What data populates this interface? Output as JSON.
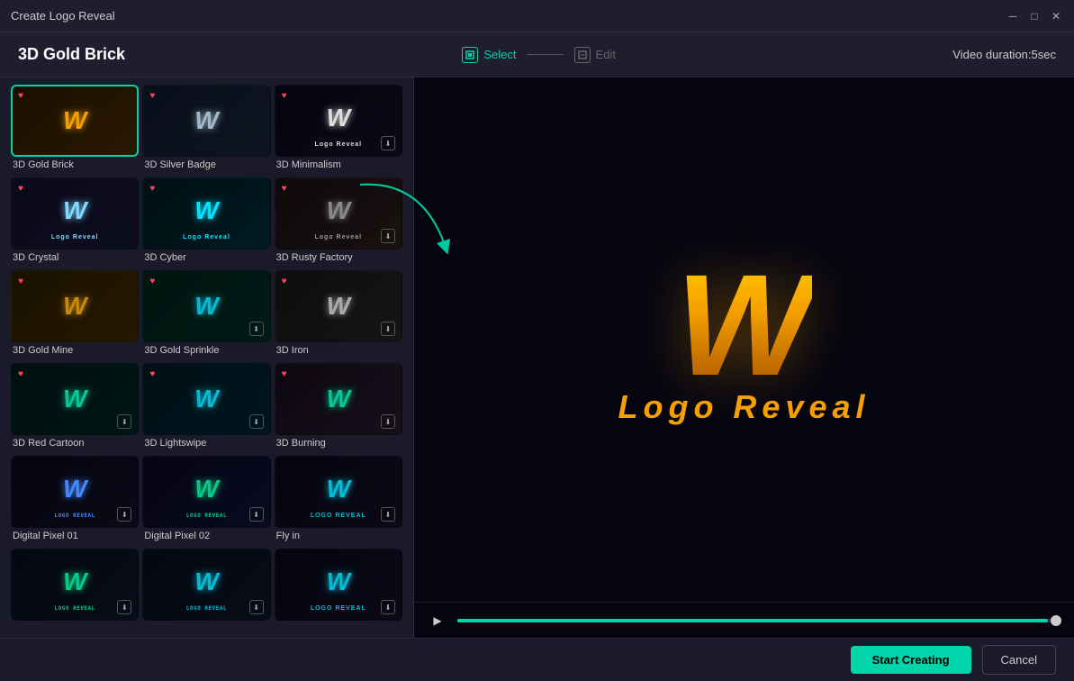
{
  "window": {
    "title": "Create Logo Reveal"
  },
  "header": {
    "title": "3D Gold Brick",
    "step1_label": "Select",
    "step2_label": "Edit",
    "duration": "Video duration:5sec"
  },
  "templates": [
    {
      "id": "3d-gold-brick",
      "name": "3D Gold Brick",
      "selected": true,
      "style": "gold-brick",
      "heart": true
    },
    {
      "id": "3d-silver-badge",
      "name": "3D Silver Badge",
      "selected": false,
      "style": "silver-badge",
      "heart": true
    },
    {
      "id": "3d-minimalism",
      "name": "3D Minimalism",
      "selected": false,
      "style": "minimalism",
      "heart": true,
      "download": true
    },
    {
      "id": "3d-crystal",
      "name": "3D Crystal",
      "selected": false,
      "style": "crystal",
      "heart": true
    },
    {
      "id": "3d-cyber",
      "name": "3D Cyber",
      "selected": false,
      "style": "cyber",
      "heart": true
    },
    {
      "id": "3d-rusty-factory",
      "name": "3D Rusty Factory",
      "selected": false,
      "style": "rusty",
      "heart": true,
      "download": true
    },
    {
      "id": "3d-gold-mine",
      "name": "3D Gold Mine",
      "selected": false,
      "style": "gold-mine",
      "heart": true
    },
    {
      "id": "3d-gold-sprinkle",
      "name": "3D Gold Sprinkle",
      "selected": false,
      "style": "sprinkle",
      "heart": true,
      "download": true
    },
    {
      "id": "3d-iron",
      "name": "3D Iron",
      "selected": false,
      "style": "iron",
      "heart": true,
      "download": true
    },
    {
      "id": "3d-red-cartoon",
      "name": "3D Red Cartoon",
      "selected": false,
      "style": "red-cartoon",
      "heart": true,
      "download": true
    },
    {
      "id": "3d-lightswipe",
      "name": "3D Lightswipe",
      "selected": false,
      "style": "lightswipe",
      "heart": true,
      "download": true
    },
    {
      "id": "3d-burning",
      "name": "3D Burning",
      "selected": false,
      "style": "burning",
      "heart": true,
      "download": true
    },
    {
      "id": "digital-pixel-01",
      "name": "Digital Pixel 01",
      "selected": false,
      "style": "pixel1",
      "heart": false,
      "download": true
    },
    {
      "id": "digital-pixel-02",
      "name": "Digital Pixel 02",
      "selected": false,
      "style": "pixel2",
      "heart": false,
      "download": true
    },
    {
      "id": "fly-in",
      "name": "Fly in",
      "selected": false,
      "style": "flyin",
      "heart": false,
      "download": true
    },
    {
      "id": "bottom-1",
      "name": "",
      "selected": false,
      "style": "bot1",
      "heart": false,
      "download": true
    },
    {
      "id": "bottom-2",
      "name": "",
      "selected": false,
      "style": "bot2",
      "heart": false,
      "download": true
    },
    {
      "id": "bottom-3",
      "name": "",
      "selected": false,
      "style": "bot3",
      "heart": false,
      "download": true
    }
  ],
  "preview": {
    "logo_text": "W",
    "reveal_text": "Logo  Reveal"
  },
  "footer": {
    "start_label": "Start Creating",
    "cancel_label": "Cancel"
  },
  "progress": {
    "value": 98
  }
}
